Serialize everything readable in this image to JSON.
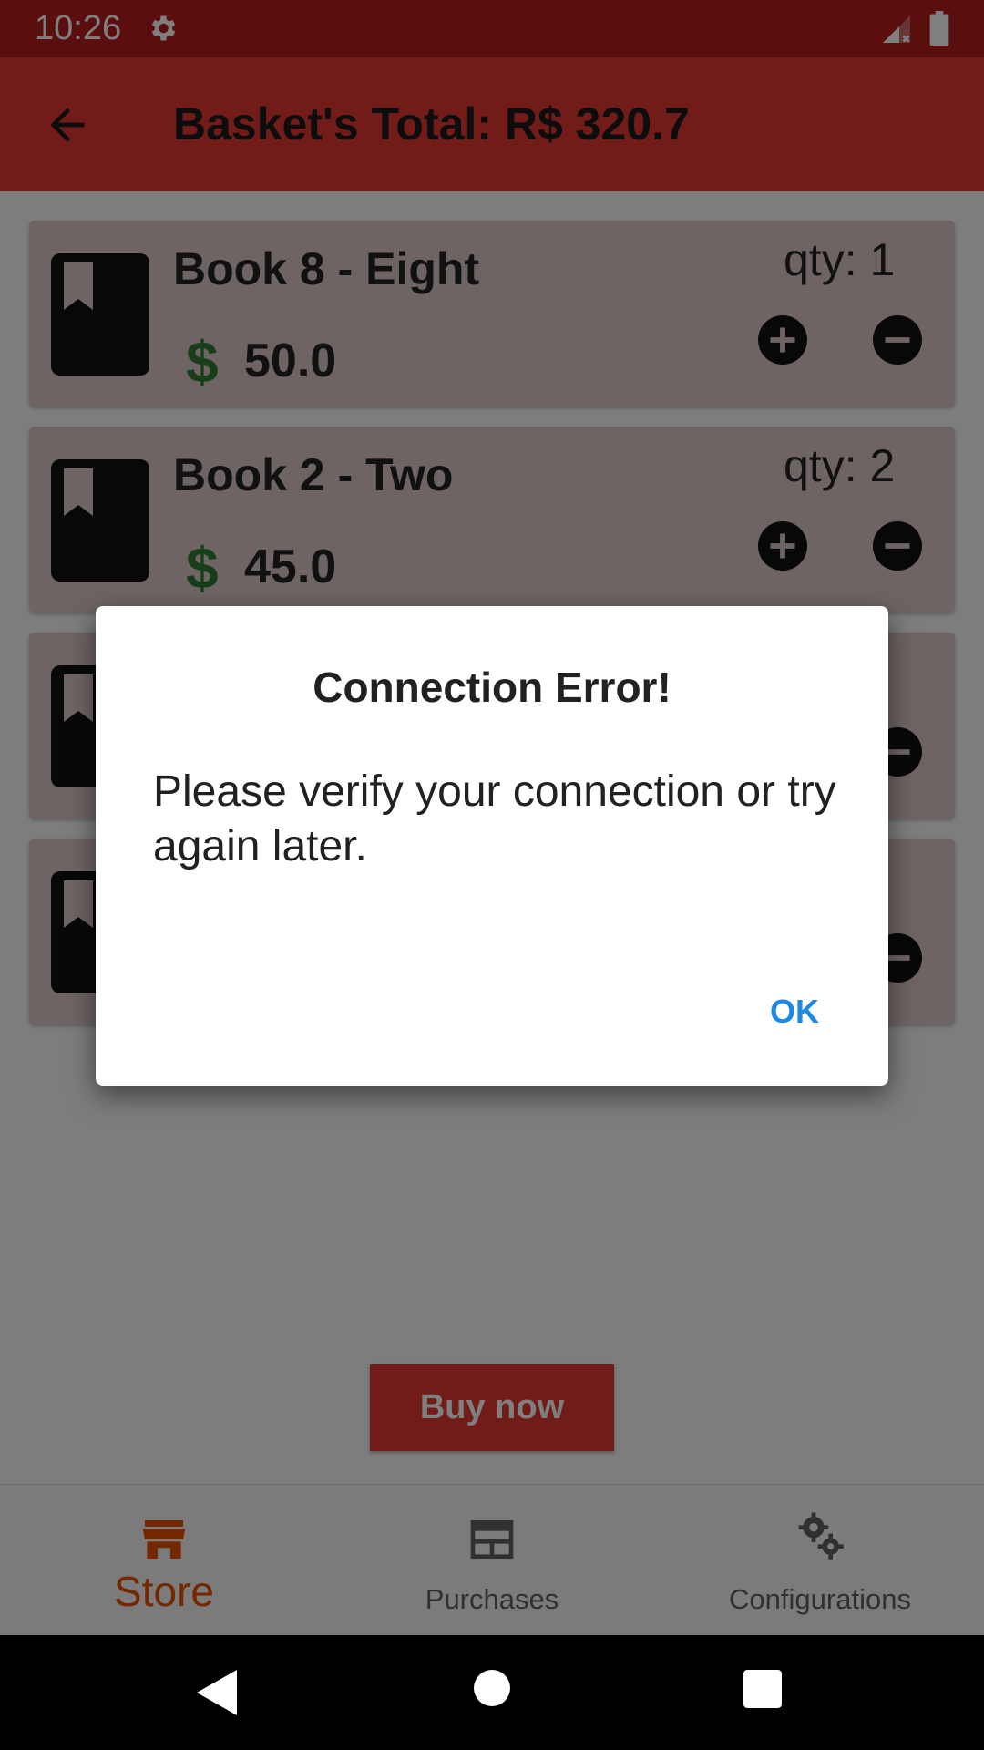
{
  "status_bar": {
    "time": "10:26"
  },
  "app_bar": {
    "title": "Basket's Total: R$ 320.7"
  },
  "items": [
    {
      "name": "Book 8 - Eight",
      "qty": "qty: 1",
      "currency": "$",
      "price": "50.0"
    },
    {
      "name": "Book 2 - Two",
      "qty": "qty: 2",
      "currency": "$",
      "price": "45.0"
    },
    {
      "name": "",
      "qty": "",
      "currency": "",
      "price": ""
    },
    {
      "name": "",
      "qty": "",
      "currency": "",
      "price": ""
    }
  ],
  "buy_button": {
    "label": "Buy now"
  },
  "bottom_nav": [
    {
      "label": "Store",
      "icon": "store-icon",
      "active": true
    },
    {
      "label": "Purchases",
      "icon": "purchases-icon",
      "active": false
    },
    {
      "label": "Configurations",
      "icon": "settings-icon",
      "active": false
    }
  ],
  "dialog": {
    "title": "Connection Error!",
    "message": "Please verify your connection or try again later.",
    "ok_label": "OK"
  },
  "colors": {
    "primary": "#e53935",
    "status_bar": "#b71c1c",
    "card": "#dcc9c9",
    "price_green": "#2e7d32",
    "active_nav": "#e65100",
    "dialog_button": "#1e88e5"
  }
}
